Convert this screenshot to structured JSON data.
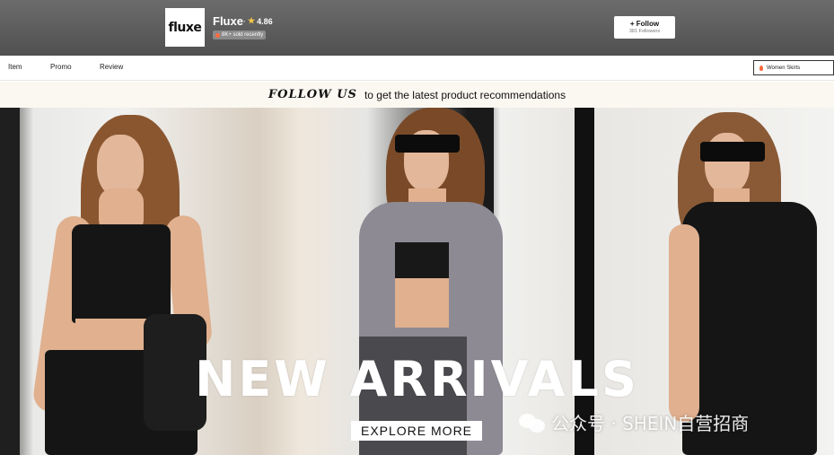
{
  "store": {
    "logo_text": "fluxe",
    "name": "Fluxe",
    "rating_separator": "·",
    "rating": "4.86",
    "sold_badge": "8K+ sold recently",
    "follow_label": "+ Follow",
    "followers": "381 Followers"
  },
  "tabs": [
    {
      "label": "Item"
    },
    {
      "label": "Promo"
    },
    {
      "label": "Review"
    }
  ],
  "category_select": {
    "value": "Women Skirts"
  },
  "follow_strip": {
    "script_text": "FOLLOW US",
    "rest_text": "to get the latest product recommendations"
  },
  "banner": {
    "headline": "NEW ARRIVALS",
    "cta": "EXPLORE MORE"
  },
  "watermark": {
    "text": "公众号 · SHEIN自营招商"
  },
  "colors": {
    "header_bg": "#5e5e5e",
    "strip_bg": "#fbf8f1",
    "star": "#f7c948",
    "badge_fire": "#ff6a3d"
  },
  "icons": [
    "star-icon",
    "fire-icon",
    "flame-icon",
    "wechat-icon"
  ]
}
